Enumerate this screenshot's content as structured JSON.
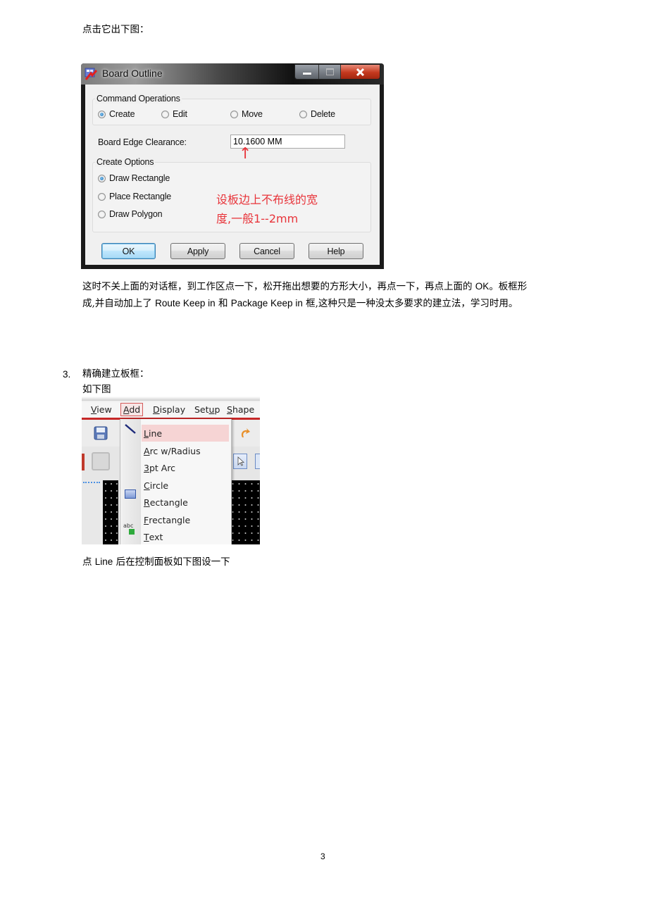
{
  "intro_text": "点击它出下图：",
  "dialog": {
    "title": "Board Outline",
    "title_icon": "app-icon",
    "window_buttons": {
      "minimize": "minimize-icon",
      "maximize": "maximize-icon",
      "close": "close-icon"
    },
    "command_operations": {
      "label": "Command Operations",
      "options": [
        {
          "label": "Create",
          "selected": true
        },
        {
          "label": "Edit",
          "selected": false
        },
        {
          "label": "Move",
          "selected": false
        },
        {
          "label": "Delete",
          "selected": false
        }
      ]
    },
    "board_edge_clearance": {
      "label": "Board Edge Clearance:",
      "value": "10.1600 MM"
    },
    "create_options": {
      "label": "Create Options",
      "options": [
        {
          "label": "Draw Rectangle",
          "selected": true
        },
        {
          "label": "Place Rectangle",
          "selected": false
        },
        {
          "label": "Draw Polygon",
          "selected": false
        }
      ]
    },
    "annotation": {
      "arrow": "↑",
      "line1": "设板边上不布线的宽",
      "line2": "度,一般1--2mm",
      "color": "#e8343a"
    },
    "buttons": {
      "ok": "OK",
      "apply": "Apply",
      "cancel": "Cancel",
      "help": "Help"
    }
  },
  "paragraph1": {
    "line1_a": "这时不关上面的对话框，到工作区点一下，松开拖出想要的方形大小，再点一下，再点上面的 ",
    "line1_ok": "OK",
    "line1_b": "。板框形",
    "line2_a": "成,并自动加上了 ",
    "line2_route": "Route Keep in",
    "line2_b": " 和 ",
    "line2_pkg": "Package Keep in",
    "line2_c": " 框,这种只是一种没太多要求的建立法，学习时用。"
  },
  "section3": {
    "number": "3.",
    "heading": "精确建立板框：",
    "subtext": "如下图"
  },
  "menu_screenshot": {
    "menubar": [
      {
        "pre": "",
        "key": "V",
        "post": "iew"
      },
      {
        "pre": "",
        "key": "A",
        "post": "dd",
        "active": true
      },
      {
        "pre": "",
        "key": "D",
        "post": "isplay"
      },
      {
        "pre": "Set",
        "key": "u",
        "post": "p"
      },
      {
        "pre": "",
        "key": "S",
        "post": "hape"
      }
    ],
    "items": [
      {
        "key": "L",
        "rest": "ine",
        "icon": "line-icon",
        "highlighted": true
      },
      {
        "key": "A",
        "rest": "rc w/Radius",
        "icon": ""
      },
      {
        "key": "3",
        "rest": "pt Arc",
        "icon": ""
      },
      {
        "key": "C",
        "rest": "ircle",
        "icon": ""
      },
      {
        "key": "R",
        "rest": "ectangle",
        "icon": "rectangle-icon"
      },
      {
        "key": "F",
        "rest": "rectangle",
        "icon": ""
      },
      {
        "key": "T",
        "rest": "ext",
        "icon": "text-icon"
      }
    ]
  },
  "paragraph2": {
    "a": "点 ",
    "line": "Line",
    "b": " 后在控制面板如下图设一下"
  },
  "page_number": "3"
}
